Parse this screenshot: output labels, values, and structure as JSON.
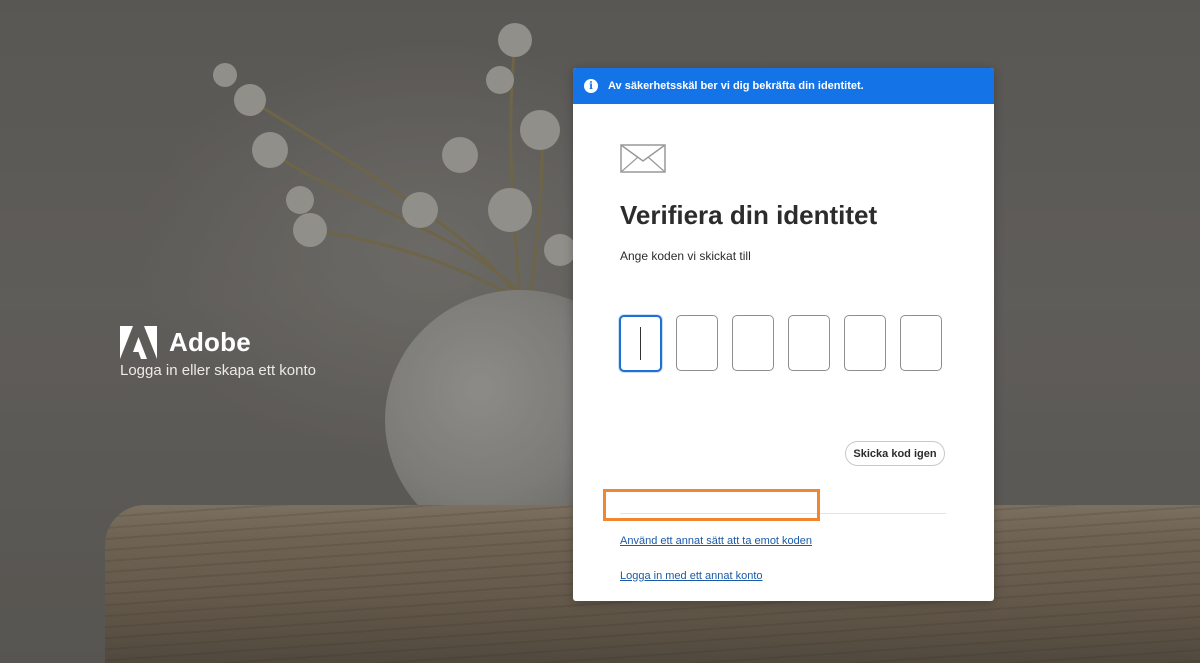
{
  "brand": {
    "name": "Adobe",
    "tagline": "Logga in eller skapa ett konto",
    "logo_icon": "adobe-logo-icon"
  },
  "banner": {
    "icon": "info-icon",
    "text": "Av säkerhetsskäl ber vi dig bekräfta din identitet.",
    "color": "#1473e6"
  },
  "verify": {
    "icon": "mail-icon",
    "title": "Verifiera din identitet",
    "subtitle": "Ange koden vi skickat till",
    "code_digits": [
      "",
      "",
      "",
      "",
      "",
      ""
    ],
    "active_digit": 1,
    "resend_label": "Skicka kod igen",
    "alt_method_link": "Använd ett annat sätt att ta emot koden",
    "other_account_link": "Logga in med ett annat konto"
  },
  "colors": {
    "accent": "#1473e6",
    "link": "#1a5aa8",
    "highlight": "#f0862d"
  }
}
